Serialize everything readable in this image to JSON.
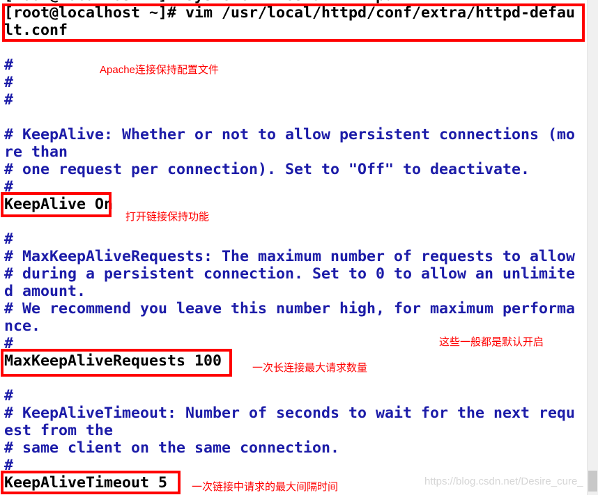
{
  "terminal": {
    "lines": [
      {
        "text": "[root@localhost ~]# systemctl restart httpd",
        "kind": "shell"
      },
      {
        "text": "[root@localhost ~]# vim /usr/local/httpd/conf/extra/httpd-defau",
        "kind": "shell"
      },
      {
        "text": "lt.conf",
        "kind": "shell"
      },
      {
        "text": "",
        "kind": "blank"
      },
      {
        "text": "#",
        "kind": "comment"
      },
      {
        "text": "#",
        "kind": "comment"
      },
      {
        "text": "#",
        "kind": "comment"
      },
      {
        "text": "",
        "kind": "blank"
      },
      {
        "text": "# KeepAlive: Whether or not to allow persistent connections (mo",
        "kind": "comment"
      },
      {
        "text": "re than",
        "kind": "comment"
      },
      {
        "text": "# one request per connection). Set to \"Off\" to deactivate.",
        "kind": "comment"
      },
      {
        "text": "#",
        "kind": "comment"
      },
      {
        "text": "KeepAlive On",
        "kind": "directive"
      },
      {
        "text": "",
        "kind": "blank"
      },
      {
        "text": "#",
        "kind": "comment"
      },
      {
        "text": "# MaxKeepAliveRequests: The maximum number of requests to allow",
        "kind": "comment"
      },
      {
        "text": "# during a persistent connection. Set to 0 to allow an unlimite",
        "kind": "comment"
      },
      {
        "text": "d amount.",
        "kind": "comment"
      },
      {
        "text": "# We recommend you leave this number high, for maximum performa",
        "kind": "comment"
      },
      {
        "text": "nce.",
        "kind": "comment"
      },
      {
        "text": "#",
        "kind": "comment"
      },
      {
        "text": "MaxKeepAliveRequests 100",
        "kind": "directive"
      },
      {
        "text": "",
        "kind": "blank"
      },
      {
        "text": "#",
        "kind": "comment"
      },
      {
        "text": "# KeepAliveTimeout: Number of seconds to wait for the next requ",
        "kind": "comment"
      },
      {
        "text": "est from the",
        "kind": "comment"
      },
      {
        "text": "# same client on the same connection.",
        "kind": "comment"
      },
      {
        "text": "#",
        "kind": "comment"
      },
      {
        "text": "KeepAliveTimeout 5",
        "kind": "directive"
      }
    ]
  },
  "annotations": {
    "config_file": "Apache连接保持配置文件",
    "keepalive": "打开链接保持功能",
    "defaults": "这些一般都是默认开启",
    "max_requests": "一次长连接最大请求数量",
    "timeout": "一次链接中请求的最大间隔时间"
  },
  "watermark": "https://blog.csdn.net/Desire_cure_",
  "colors": {
    "highlight": "#ff0000",
    "comment": "#1c1ca8",
    "text": "#000000"
  }
}
